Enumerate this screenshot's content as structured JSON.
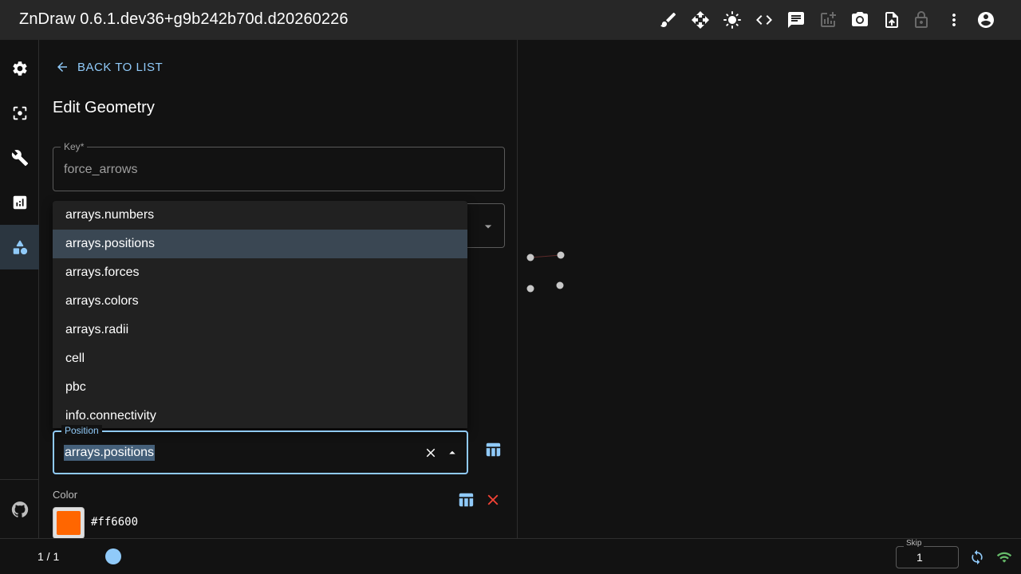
{
  "app": {
    "title": "ZnDraw 0.6.1.dev36+g9b242b70d.d20260226"
  },
  "toolbar": {
    "icons": [
      "brush-icon",
      "move-icon",
      "sun-icon",
      "code-icon",
      "chat-icon",
      "add-chart-icon",
      "camera-icon",
      "upload-icon",
      "lock-icon",
      "more-vert-icon",
      "account-icon"
    ]
  },
  "sidebar": {
    "items": [
      "settings-icon",
      "selection-icon",
      "build-icon",
      "analytics-icon",
      "geometry-icon"
    ],
    "active": "geometry-icon",
    "footer": "github-icon"
  },
  "panel": {
    "back_label": "BACK TO LIST",
    "title": "Edit Geometry",
    "key_label": "Key",
    "key_required": "*",
    "key_value": "force_arrows"
  },
  "dropdown": {
    "options": [
      "arrays.numbers",
      "arrays.positions",
      "arrays.forces",
      "arrays.colors",
      "arrays.radii",
      "cell",
      "pbc",
      "info.connectivity"
    ],
    "selected_index": 1
  },
  "position_field": {
    "label": "Position",
    "value": "arrays.positions"
  },
  "color_field": {
    "label": "Color",
    "hex": "#ff6600",
    "swatch_color": "#ff6600"
  },
  "bottom": {
    "frame_counter": "1 / 1",
    "skip_label": "Skip",
    "skip_value": "1",
    "slider_fraction": 0
  },
  "colors": {
    "accent": "#90caf9",
    "danger": "#f44336",
    "connected": "#66bb6a"
  }
}
